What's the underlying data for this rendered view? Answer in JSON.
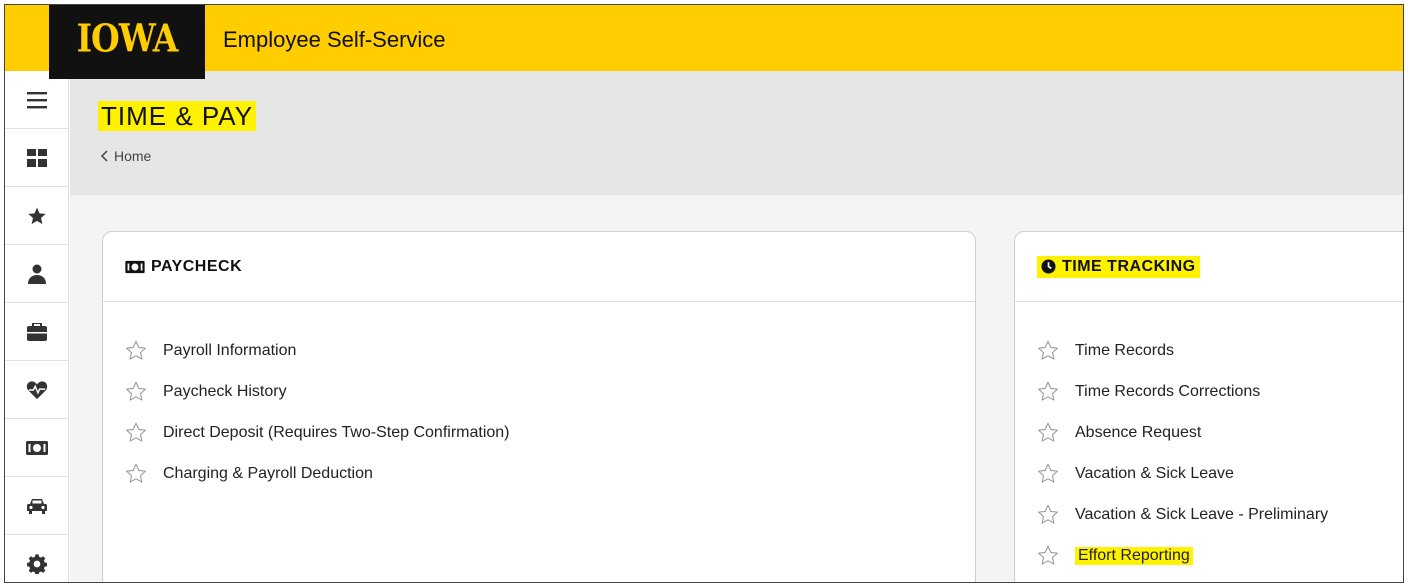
{
  "header": {
    "logo_text": "IOWA",
    "app_title": "Employee Self-Service"
  },
  "sidebar": {
    "items": [
      {
        "icon": "hamburger-menu-icon"
      },
      {
        "icon": "dashboard-grid-icon"
      },
      {
        "icon": "star-icon"
      },
      {
        "icon": "person-icon"
      },
      {
        "icon": "briefcase-icon"
      },
      {
        "icon": "heart-pulse-icon"
      },
      {
        "icon": "money-icon"
      },
      {
        "icon": "car-icon"
      },
      {
        "icon": "gear-icon"
      }
    ]
  },
  "page": {
    "title": "TIME & PAY",
    "breadcrumb": "Home"
  },
  "paycheck": {
    "title": "PAYCHECK",
    "items": [
      "Payroll Information",
      "Paycheck History",
      "Direct Deposit (Requires Two-Step Confirmation)",
      "Charging & Payroll Deduction"
    ]
  },
  "time_tracking": {
    "title": "TIME TRACKING",
    "items": [
      "Time Records",
      "Time Records Corrections",
      "Absence Request",
      "Vacation & Sick Leave",
      "Vacation & Sick Leave - Preliminary",
      "Effort Reporting"
    ]
  },
  "colors": {
    "brand_gold": "#FFCD00",
    "brand_black": "#111111",
    "highlight": "#FFF200"
  }
}
